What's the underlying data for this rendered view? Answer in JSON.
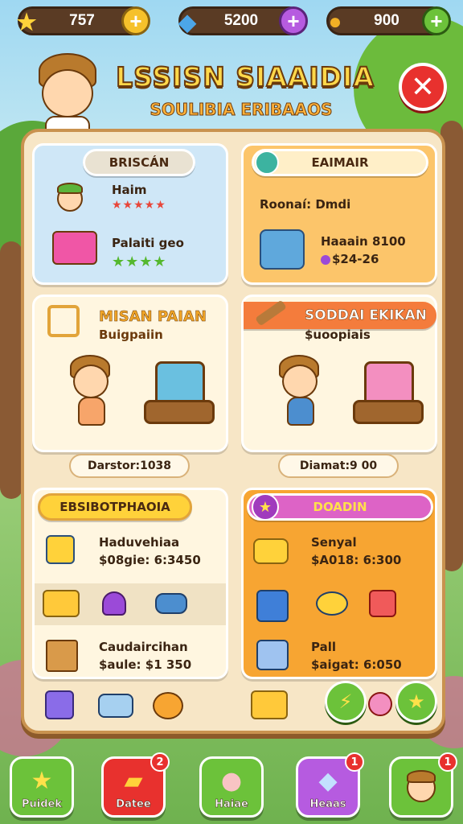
{
  "colors": {
    "accent": "#ffd84a",
    "close": "#e8312e",
    "green": "#6cc23a",
    "purple": "#b65be0",
    "orange": "#f7a532",
    "panel": "#f7e6c6"
  },
  "resources": [
    {
      "icon": "star-icon",
      "value": "757"
    },
    {
      "icon": "gem-icon",
      "value": "5200"
    },
    {
      "icon": "coin-icon",
      "value": "900"
    }
  ],
  "header": {
    "title": "LSSISN SIAAIDIA",
    "subtitle": "SOULIBIA ERIBAAOS",
    "close_icon": "close-icon"
  },
  "card1": {
    "pill": "BRISCÁN",
    "row1_title": "Haim",
    "row2_title": "Palaiti geo",
    "rating1": 5,
    "rating2": 4
  },
  "card2": {
    "pill": "EAIMAIR",
    "line1": "Roonaí: Dmdi",
    "line2": "Haaain 8100",
    "line3": "$24-26"
  },
  "card3": {
    "title": "MISAN PAIAN",
    "subtitle": "Buigpaiin",
    "chip": "Darstor:1038"
  },
  "card4": {
    "title": "SODDAI EKIKAN",
    "subtitle": "$uoopiais",
    "chip": "Diamat:9 00"
  },
  "card5": {
    "pill": "EBSIBOTPHAOIA",
    "row1_title": "Haduvehiaa",
    "row1_price": "$08gie: 6:3450",
    "row2_title": "Caudaircihan",
    "row2_price": "$aule: $1 350"
  },
  "card6": {
    "pill": "DOADIN",
    "row1_title": "Senyal",
    "row1_price": "$A018: 6:300",
    "row2_title": "Pall",
    "row2_price": "$aigat: 6:050"
  },
  "nav": [
    {
      "label": "Puidek",
      "icon": "star-icon",
      "badge": ""
    },
    {
      "label": "Datee",
      "icon": "treasure-chest-icon",
      "badge": "2"
    },
    {
      "label": "Haiae",
      "icon": "cat-icon",
      "badge": ""
    },
    {
      "label": "Heaas",
      "icon": "gem-icon",
      "badge": "1"
    },
    {
      "label": "",
      "icon": "avatar-icon",
      "badge": "1"
    }
  ]
}
